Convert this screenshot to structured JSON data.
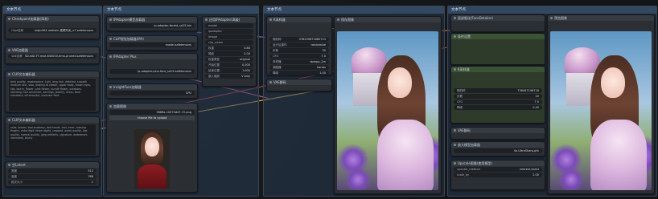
{
  "groups": [
    {
      "title": "文本节点"
    },
    {
      "title": "文本节点"
    },
    {
      "title": "文本节点"
    },
    {
      "title": "文本节点"
    }
  ],
  "nodes": {
    "checkpoint": {
      "title": "Checkpoint加载器(简易)",
      "ckpt_label": "Ckpt名称",
      "ckpt_value": "majicMIX realistic 麦橘写实_v7.safetensors"
    },
    "vae": {
      "title": "VAE加载器",
      "vae_label": "VAE名称",
      "vae_value": "SD-VAE-FT-mse-840000-ema-pruned.safetensors"
    },
    "clip_pos": {
      "title": "CLIP文本编码器",
      "text": "best quality, masterpiece, 1girl, long hair, detailed, smooth medium skin, solo, looking at viewer, upper body, brown eyes, lips, blurry, flower, pink flower, purple flower, outdoors, standing, hair ornament, earrings, jewelry, dress, bare shoulders, off shoulder, lavender field"
    },
    "clip_neg": {
      "title": "CLIP文本编码器",
      "text": "nsfw, lowres, bad anatomy, bad hands, text, error, missing fingers, extra digit, fewer digits, cropped, worst quality, low quality, normal quality, jpeg artifacts, signature, watermark, username, blurry"
    },
    "latent": {
      "title": "空Latent",
      "rows": [
        {
          "k": "宽度",
          "v": "512"
        },
        {
          "k": "高度",
          "v": "768"
        },
        {
          "k": "批次大小",
          "v": "1"
        }
      ]
    },
    "ipadapter_loader": {
      "title": "IPAdapter模型加载器",
      "value": "ip-adapter-faceid_sd15.bin"
    },
    "clipvision": {
      "title": "CLIP视觉加载器(IPA)",
      "value": "model.safetensors"
    },
    "ipa_plus": {
      "title": "IPAdapter Plus",
      "value": "ip-adapter-plus-face_sd15.safetensors"
    },
    "insightface": {
      "title": "InsightFace加载器",
      "value": "CPU"
    },
    "loadimage": {
      "title": "加载图像",
      "image": "3689a-10074d47-72.png",
      "upload": "choose file to upload"
    },
    "apply_ipa": {
      "title": "应用IPAdapter(高级)",
      "rows": [
        {
          "k": "model",
          "v": ""
        },
        {
          "k": "ipadapter",
          "v": ""
        },
        {
          "k": "image",
          "v": ""
        },
        {
          "k": "clip_vision",
          "v": ""
        },
        {
          "k": "权重",
          "v": "0.80"
        },
        {
          "k": "噪波",
          "v": "0.00"
        },
        {
          "k": "权重类型",
          "v": "original"
        },
        {
          "k": "开始位置",
          "v": "0.000"
        },
        {
          "k": "结束位置",
          "v": "1.000"
        },
        {
          "k": "嵌入缩放",
          "v": "V only"
        }
      ]
    },
    "ksampler": {
      "title": "K采样器",
      "rows": [
        {
          "k": "随机种",
          "v": "976209671860713"
        },
        {
          "k": "运行后操作",
          "v": "randomize"
        },
        {
          "k": "步数",
          "v": "30"
        },
        {
          "k": "CFG",
          "v": "7.0"
        },
        {
          "k": "采样器",
          "v": "dpmpp_2m"
        },
        {
          "k": "调度器",
          "v": "karras"
        },
        {
          "k": "降噪",
          "v": "1.00"
        }
      ]
    },
    "vae_decode": {
      "title": "VAE解码"
    },
    "preview1": {
      "title": "预览图像"
    },
    "save1": {
      "title": "保存图像"
    },
    "right_face": {
      "title": "面部细化(FaceDetailer)"
    },
    "right_cond": {
      "title": "条件设置"
    },
    "right_ks": {
      "title": "K采样器",
      "rows": [
        {
          "k": "随机种",
          "v": "736497198716"
        },
        {
          "k": "步数",
          "v": "20"
        },
        {
          "k": "CFG",
          "v": "7.0"
        },
        {
          "k": "降噪",
          "v": "0.45"
        }
      ]
    },
    "right_vae": {
      "title": "VAE解码"
    },
    "right_upscale": {
      "title": "放大模型加载器",
      "value": "4x-UltraSharp.pth"
    },
    "right_scale": {
      "title": "Upscale图像(使用模型)",
      "rows": [
        {
          "k": "upscale_method",
          "v": "nearest-exact"
        },
        {
          "k": "scale_by",
          "v": "2.00"
        }
      ]
    },
    "preview2": {
      "title": "预览图像"
    }
  },
  "colors": {
    "wire_pink": "#e0609a",
    "wire_yellow": "#e8c34a",
    "wire_orange": "#e08a3c",
    "wire_purple": "#a26ad8",
    "wire_red": "#d14a4a",
    "wire_green": "#6fbf5a"
  }
}
